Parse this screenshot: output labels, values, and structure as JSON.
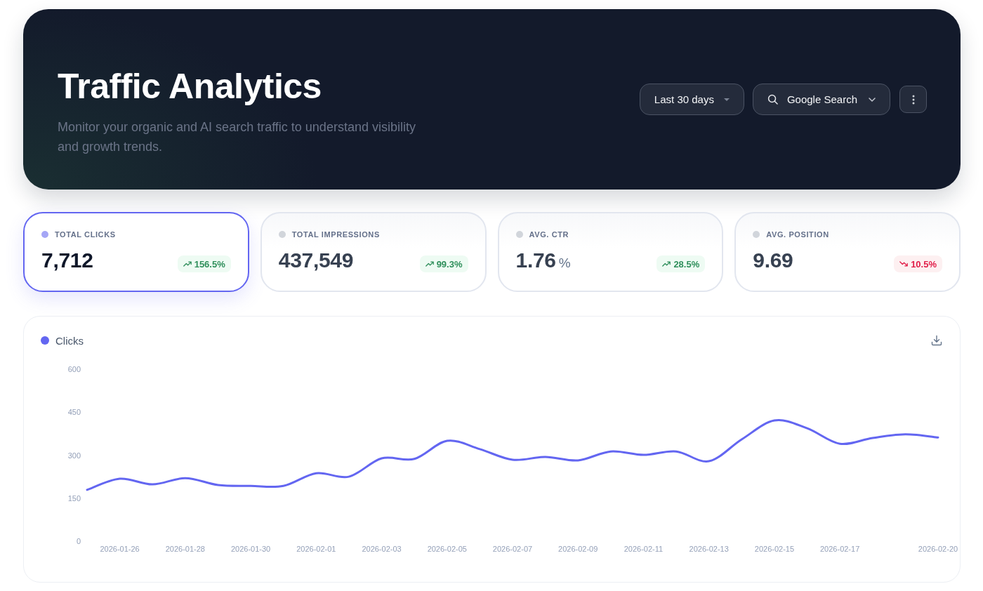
{
  "header": {
    "title": "Traffic Analytics",
    "subtitle": "Monitor your organic and AI search traffic to understand visibility and growth trends.",
    "controls": [
      {
        "kind": "select",
        "label": "Last 30 days"
      },
      {
        "kind": "search-select",
        "label": "Google Search"
      },
      {
        "kind": "menu"
      }
    ]
  },
  "metrics": [
    {
      "label": "TOTAL CLICKS",
      "value": "7,712",
      "change": "156.5%",
      "decreasing": false,
      "selected": true
    },
    {
      "label": "TOTAL IMPRESSIONS",
      "value": "437,549",
      "change": "99.3%",
      "decreasing": false,
      "selected": false
    },
    {
      "label": "AVG. CTR",
      "value": "1.76",
      "unit": "%",
      "change": "28.5%",
      "decreasing": false,
      "selected": false
    },
    {
      "label": "AVG. POSITION",
      "value": "9.69",
      "change": "10.5%",
      "decreasing": true,
      "selected": false
    }
  ],
  "chart": {
    "chart_data": {
      "type": "line",
      "categories": [
        null,
        "2026-01-26",
        null,
        "2026-01-28",
        null,
        "2026-01-30",
        null,
        "2026-02-01",
        null,
        "2026-02-03",
        null,
        "2026-02-05",
        null,
        "2026-02-07",
        null,
        "2026-02-09",
        null,
        "2026-02-11",
        null,
        "2026-02-13",
        null,
        "2026-02-15",
        null,
        "2026-02-17",
        null,
        null,
        "2026-02-20"
      ],
      "series": [
        {
          "name": "Clicks",
          "color": "#6366f1",
          "values": [
            179,
            218,
            198,
            220,
            196,
            193,
            193,
            237,
            225,
            289,
            287,
            350,
            321,
            284,
            294,
            282,
            313,
            301,
            313,
            279,
            355,
            421,
            394,
            340,
            360,
            373,
            362
          ]
        }
      ],
      "ylim": [
        0,
        600
      ],
      "yticks": [
        0,
        150,
        300,
        450,
        600
      ]
    }
  }
}
